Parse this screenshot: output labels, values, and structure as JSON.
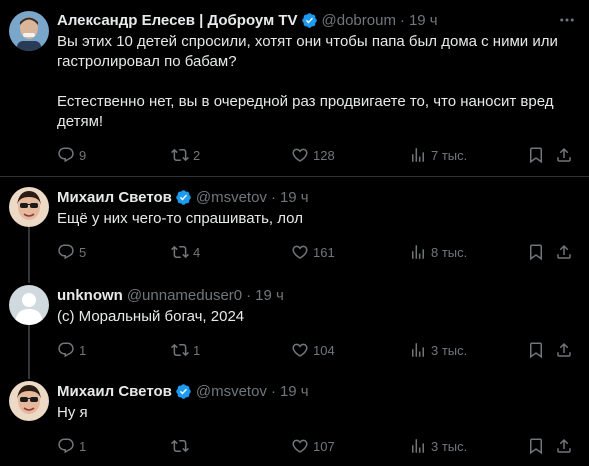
{
  "tweets": [
    {
      "name": "Александр Елесев | Доброум TV",
      "verified": true,
      "handle": "@dobroum",
      "time": "19 ч",
      "text_lines": [
        "Вы этих 10 детей спросили, хотят они чтобы папа был дома с ними или гастролировал по бабам?",
        "Естественно нет, вы в очередной раз продвигаете то, что наносит вред детям!"
      ],
      "replies": "9",
      "retweets": "2",
      "likes": "128",
      "views": "7 тыс."
    },
    {
      "name": "Михаил Светов",
      "verified": true,
      "handle": "@msvetov",
      "time": "19 ч",
      "text_lines": [
        "Ещё у них чего-то спрашивать, лол"
      ],
      "replies": "5",
      "retweets": "4",
      "likes": "161",
      "views": "8 тыс."
    },
    {
      "name": "unknown",
      "verified": false,
      "handle": "@unnameduser0",
      "time": "19 ч",
      "text_lines": [
        "(с) Моральный богач, 2024"
      ],
      "replies": "1",
      "retweets": "1",
      "likes": "104",
      "views": "3 тыс."
    },
    {
      "name": "Михаил Светов",
      "verified": true,
      "handle": "@msvetov",
      "time": "19 ч",
      "text_lines": [
        "Ну я"
      ],
      "replies": "1",
      "retweets": "",
      "likes": "107",
      "views": "3 тыс."
    }
  ],
  "separator": "·",
  "colors": {
    "background": "#000000",
    "text": "#e7e9ea",
    "muted": "#71767b",
    "verified": "#1d9bf0",
    "divider": "#2f3336"
  },
  "icons": [
    "more-icon",
    "reply-icon",
    "retweet-icon",
    "like-icon",
    "views-icon",
    "bookmark-icon",
    "share-icon",
    "verified-badge-icon"
  ]
}
